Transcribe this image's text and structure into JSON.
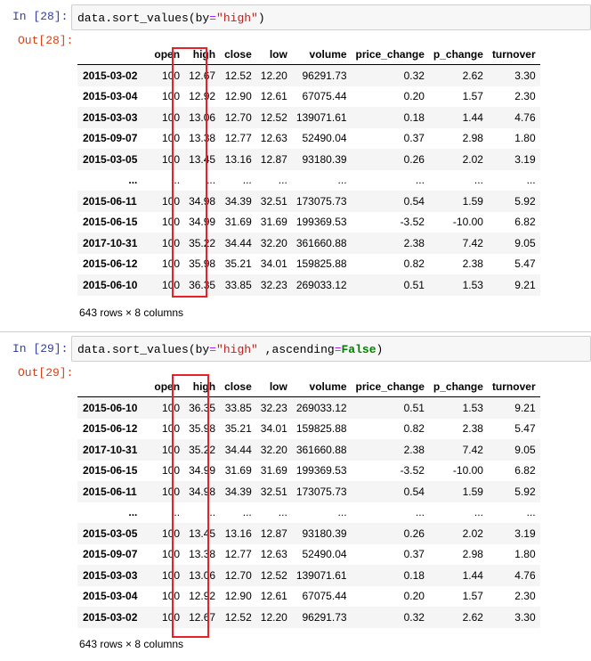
{
  "cells": [
    {
      "in_prompt": "In  [28]:",
      "out_prompt": "Out[28]:",
      "code": {
        "obj": "data.sort_values(by",
        "eq": "=",
        "arg": "\"high\"",
        "rest": "",
        "eq2": "",
        "kw": "",
        "close": ")"
      },
      "columns": [
        "",
        "open",
        "high",
        "close",
        "low",
        "volume",
        "price_change",
        "p_change",
        "turnover"
      ],
      "rows": [
        [
          "2015-03-02",
          "100",
          "12.67",
          "12.52",
          "12.20",
          "96291.73",
          "0.32",
          "2.62",
          "3.30"
        ],
        [
          "2015-03-04",
          "100",
          "12.92",
          "12.90",
          "12.61",
          "67075.44",
          "0.20",
          "1.57",
          "2.30"
        ],
        [
          "2015-03-03",
          "100",
          "13.06",
          "12.70",
          "12.52",
          "139071.61",
          "0.18",
          "1.44",
          "4.76"
        ],
        [
          "2015-09-07",
          "100",
          "13.38",
          "12.77",
          "12.63",
          "52490.04",
          "0.37",
          "2.98",
          "1.80"
        ],
        [
          "2015-03-05",
          "100",
          "13.45",
          "13.16",
          "12.87",
          "93180.39",
          "0.26",
          "2.02",
          "3.19"
        ],
        [
          "...",
          "...",
          "...",
          "...",
          "...",
          "...",
          "...",
          "...",
          "..."
        ],
        [
          "2015-06-11",
          "100",
          "34.98",
          "34.39",
          "32.51",
          "173075.73",
          "0.54",
          "1.59",
          "5.92"
        ],
        [
          "2015-06-15",
          "100",
          "34.99",
          "31.69",
          "31.69",
          "199369.53",
          "-3.52",
          "-10.00",
          "6.82"
        ],
        [
          "2017-10-31",
          "100",
          "35.22",
          "34.44",
          "32.20",
          "361660.88",
          "2.38",
          "7.42",
          "9.05"
        ],
        [
          "2015-06-12",
          "100",
          "35.98",
          "35.21",
          "34.01",
          "159825.88",
          "0.82",
          "2.38",
          "5.47"
        ],
        [
          "2015-06-10",
          "100",
          "36.35",
          "33.85",
          "32.23",
          "269033.12",
          "0.51",
          "1.53",
          "9.21"
        ]
      ],
      "shape": "643 rows × 8 columns"
    },
    {
      "in_prompt": "In  [29]:",
      "out_prompt": "Out[29]:",
      "code": {
        "obj": "data.sort_values(by",
        "eq": "=",
        "arg": "\"high\"",
        "rest": " ,ascending",
        "eq2": "=",
        "kw": "False",
        "close": ")"
      },
      "columns": [
        "",
        "open",
        "high",
        "close",
        "low",
        "volume",
        "price_change",
        "p_change",
        "turnover"
      ],
      "rows": [
        [
          "2015-06-10",
          "100",
          "36.35",
          "33.85",
          "32.23",
          "269033.12",
          "0.51",
          "1.53",
          "9.21"
        ],
        [
          "2015-06-12",
          "100",
          "35.98",
          "35.21",
          "34.01",
          "159825.88",
          "0.82",
          "2.38",
          "5.47"
        ],
        [
          "2017-10-31",
          "100",
          "35.22",
          "34.44",
          "32.20",
          "361660.88",
          "2.38",
          "7.42",
          "9.05"
        ],
        [
          "2015-06-15",
          "100",
          "34.99",
          "31.69",
          "31.69",
          "199369.53",
          "-3.52",
          "-10.00",
          "6.82"
        ],
        [
          "2015-06-11",
          "100",
          "34.98",
          "34.39",
          "32.51",
          "173075.73",
          "0.54",
          "1.59",
          "5.92"
        ],
        [
          "...",
          "...",
          "...",
          "...",
          "...",
          "...",
          "...",
          "...",
          "..."
        ],
        [
          "2015-03-05",
          "100",
          "13.45",
          "13.16",
          "12.87",
          "93180.39",
          "0.26",
          "2.02",
          "3.19"
        ],
        [
          "2015-09-07",
          "100",
          "13.38",
          "12.77",
          "12.63",
          "52490.04",
          "0.37",
          "2.98",
          "1.80"
        ],
        [
          "2015-03-03",
          "100",
          "13.06",
          "12.70",
          "12.52",
          "139071.61",
          "0.18",
          "1.44",
          "4.76"
        ],
        [
          "2015-03-04",
          "100",
          "12.92",
          "12.90",
          "12.61",
          "67075.44",
          "0.20",
          "1.57",
          "2.30"
        ],
        [
          "2015-03-02",
          "100",
          "12.67",
          "12.52",
          "12.20",
          "96291.73",
          "0.32",
          "2.62",
          "3.30"
        ]
      ],
      "shape": "643 rows × 8 columns"
    }
  ],
  "colors": {
    "highlight": "#e8202a",
    "in_prompt": "#303f9f",
    "out_prompt": "#d84315"
  }
}
